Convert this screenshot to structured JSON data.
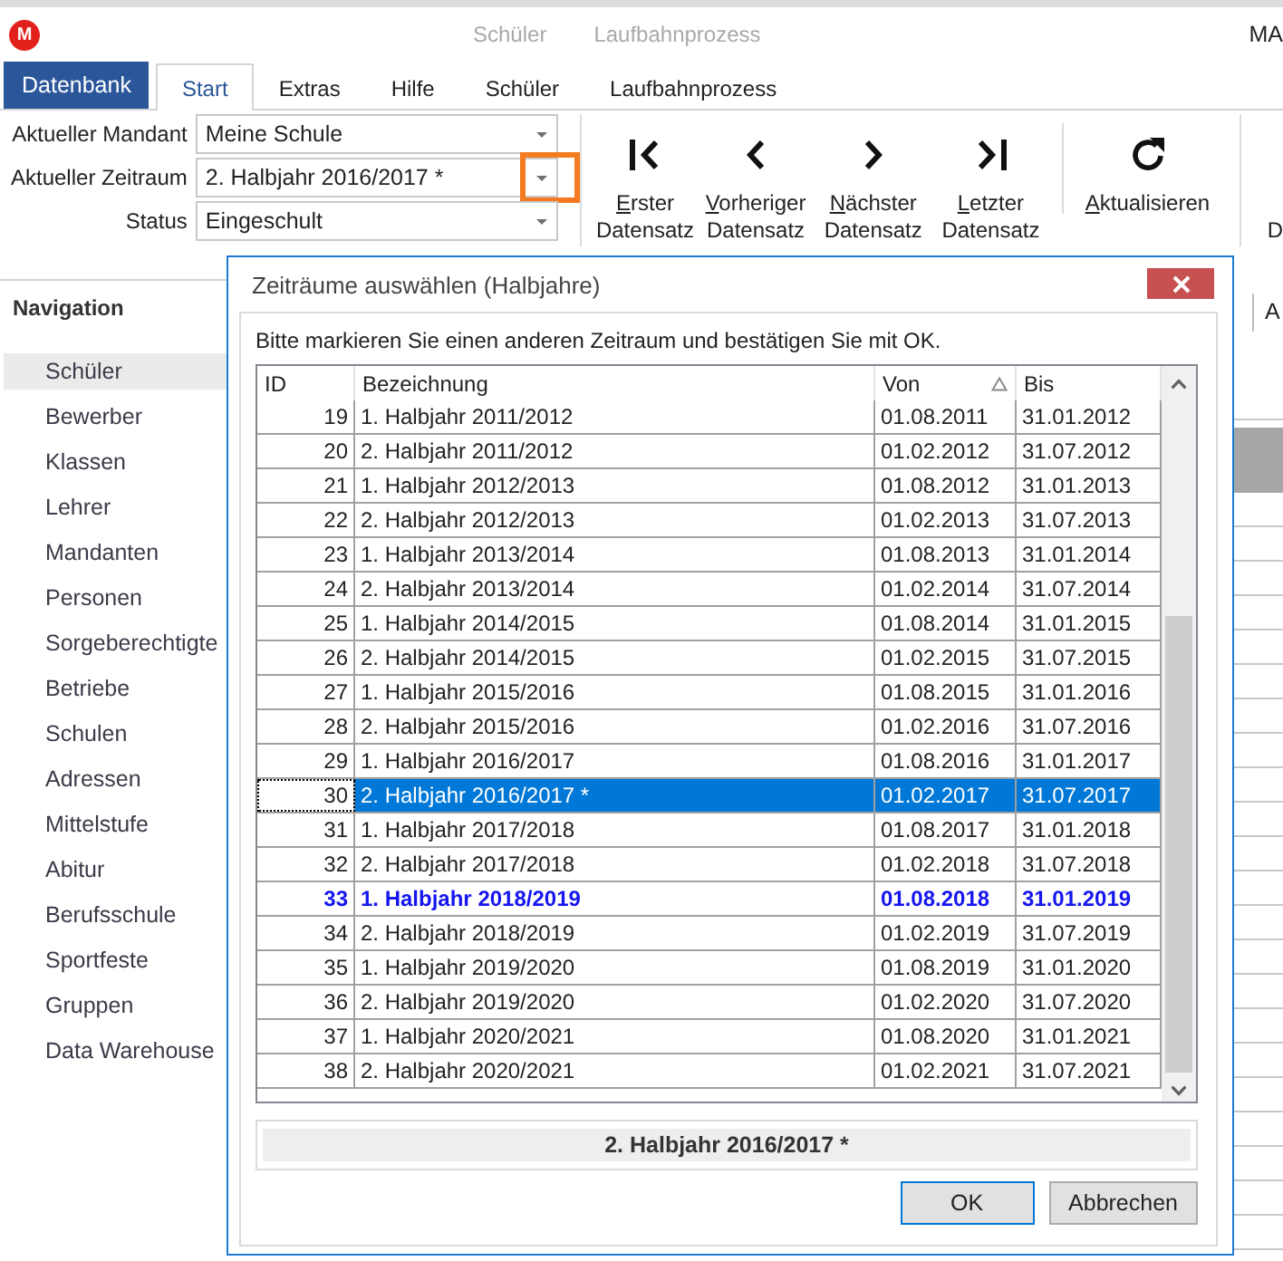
{
  "app": {
    "logo": "M",
    "context_titles": [
      "Schüler",
      "Laufbahnprozess"
    ],
    "title": "MA"
  },
  "ribbon": {
    "file_button": "Datenbank",
    "tabs": [
      {
        "label": "Start",
        "selected": true
      },
      {
        "label": "Extras",
        "selected": false
      },
      {
        "label": "Hilfe",
        "selected": false
      },
      {
        "label": "Schüler",
        "selected": false
      },
      {
        "label": "Laufbahnprozess",
        "selected": false
      }
    ],
    "fields": [
      {
        "label": "Aktueller Mandant",
        "value": "Meine Schule",
        "highlighted": false
      },
      {
        "label": "Aktueller Zeitraum",
        "value": "2. Halbjahr 2016/2017 *",
        "highlighted": true
      },
      {
        "label": "Status",
        "value": "Eingeschult",
        "highlighted": false
      }
    ],
    "nav_buttons": [
      {
        "kind": "first",
        "label": "Erster Datensatz",
        "mnemonic": true
      },
      {
        "kind": "previous",
        "label": "Vorheriger Datensatz",
        "mnemonic": true
      },
      {
        "kind": "next",
        "label": "Nächster Datensatz",
        "mnemonic": true
      },
      {
        "kind": "last",
        "label": "Letzter Datensatz",
        "mnemonic": true
      }
    ],
    "refresh_button": {
      "label": "Aktualisieren",
      "mnemonic": true
    },
    "cut_button": {
      "label": "D"
    }
  },
  "navigation": {
    "title": "Navigation",
    "items": [
      {
        "label": "Schüler",
        "selected": true
      },
      {
        "label": "Bewerber",
        "selected": false
      },
      {
        "label": "Klassen",
        "selected": false
      },
      {
        "label": "Lehrer",
        "selected": false
      },
      {
        "label": "Mandanten",
        "selected": false
      },
      {
        "label": "Personen",
        "selected": false
      },
      {
        "label": "Sorgeberechtigte",
        "selected": false
      },
      {
        "label": "Betriebe",
        "selected": false
      },
      {
        "label": "Schulen",
        "selected": false
      },
      {
        "label": "Adressen",
        "selected": false
      },
      {
        "label": "Mittelstufe",
        "selected": false
      },
      {
        "label": "Abitur",
        "selected": false
      },
      {
        "label": "Berufsschule",
        "selected": false
      },
      {
        "label": "Sportfeste",
        "selected": false
      },
      {
        "label": "Gruppen",
        "selected": false
      },
      {
        "label": "Data Warehouse",
        "selected": false
      }
    ]
  },
  "workspace": {
    "tabs": [
      "A"
    ]
  },
  "dialog": {
    "title": "Zeiträume auswählen (Halbjahre)",
    "instruction": "Bitte markieren Sie einen anderen Zeitraum und bestätigen Sie mit OK.",
    "table": {
      "columns": [
        {
          "label": "ID",
          "sorted": false
        },
        {
          "label": "Bezeichnung",
          "sorted": false
        },
        {
          "label": "Von",
          "sorted": true
        },
        {
          "label": "Bis",
          "sorted": false
        }
      ],
      "rows": [
        {
          "cells": [
            "19",
            "1. Halbjahr 2011/2012",
            "01.08.2011",
            "31.01.2012"
          ],
          "selected": false,
          "current": false
        },
        {
          "cells": [
            "20",
            "2. Halbjahr 2011/2012",
            "01.02.2012",
            "31.07.2012"
          ],
          "selected": false,
          "current": false
        },
        {
          "cells": [
            "21",
            "1. Halbjahr 2012/2013",
            "01.08.2012",
            "31.01.2013"
          ],
          "selected": false,
          "current": false
        },
        {
          "cells": [
            "22",
            "2. Halbjahr 2012/2013",
            "01.02.2013",
            "31.07.2013"
          ],
          "selected": false,
          "current": false
        },
        {
          "cells": [
            "23",
            "1. Halbjahr 2013/2014",
            "01.08.2013",
            "31.01.2014"
          ],
          "selected": false,
          "current": false
        },
        {
          "cells": [
            "24",
            "2. Halbjahr 2013/2014",
            "01.02.2014",
            "31.07.2014"
          ],
          "selected": false,
          "current": false
        },
        {
          "cells": [
            "25",
            "1. Halbjahr 2014/2015",
            "01.08.2014",
            "31.01.2015"
          ],
          "selected": false,
          "current": false
        },
        {
          "cells": [
            "26",
            "2. Halbjahr 2014/2015",
            "01.02.2015",
            "31.07.2015"
          ],
          "selected": false,
          "current": false
        },
        {
          "cells": [
            "27",
            "1. Halbjahr 2015/2016",
            "01.08.2015",
            "31.01.2016"
          ],
          "selected": false,
          "current": false
        },
        {
          "cells": [
            "28",
            "2. Halbjahr 2015/2016",
            "01.02.2016",
            "31.07.2016"
          ],
          "selected": false,
          "current": false
        },
        {
          "cells": [
            "29",
            "1. Halbjahr 2016/2017",
            "01.08.2016",
            "31.01.2017"
          ],
          "selected": false,
          "current": false
        },
        {
          "cells": [
            "30",
            "2. Halbjahr 2016/2017 *",
            "01.02.2017",
            "31.07.2017"
          ],
          "selected": true,
          "current": false
        },
        {
          "cells": [
            "31",
            "1. Halbjahr 2017/2018",
            "01.08.2017",
            "31.01.2018"
          ],
          "selected": false,
          "current": false
        },
        {
          "cells": [
            "32",
            "2. Halbjahr 2017/2018",
            "01.02.2018",
            "31.07.2018"
          ],
          "selected": false,
          "current": false
        },
        {
          "cells": [
            "33",
            "1. Halbjahr 2018/2019",
            "01.08.2018",
            "31.01.2019"
          ],
          "selected": false,
          "current": true
        },
        {
          "cells": [
            "34",
            "2. Halbjahr 2018/2019",
            "01.02.2019",
            "31.07.2019"
          ],
          "selected": false,
          "current": false
        },
        {
          "cells": [
            "35",
            "1. Halbjahr 2019/2020",
            "01.08.2019",
            "31.01.2020"
          ],
          "selected": false,
          "current": false
        },
        {
          "cells": [
            "36",
            "2. Halbjahr 2019/2020",
            "01.02.2020",
            "31.07.2020"
          ],
          "selected": false,
          "current": false
        },
        {
          "cells": [
            "37",
            "1. Halbjahr 2020/2021",
            "01.08.2020",
            "31.01.2021"
          ],
          "selected": false,
          "current": false
        },
        {
          "cells": [
            "38",
            "2. Halbjahr 2020/2021",
            "01.02.2021",
            "31.07.2021"
          ],
          "selected": false,
          "current": false
        }
      ]
    },
    "selection": "2. Halbjahr 2016/2017 *",
    "buttons": [
      {
        "label": "OK",
        "default": true
      },
      {
        "label": "Abbrechen",
        "default": false
      }
    ]
  }
}
